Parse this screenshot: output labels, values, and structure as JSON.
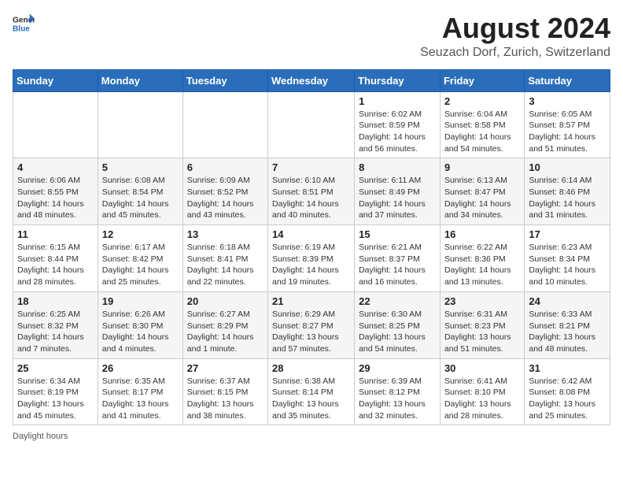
{
  "logo": {
    "text_general": "General",
    "text_blue": "Blue"
  },
  "title": "August 2024",
  "subtitle": "Seuzach Dorf, Zurich, Switzerland",
  "days_of_week": [
    "Sunday",
    "Monday",
    "Tuesday",
    "Wednesday",
    "Thursday",
    "Friday",
    "Saturday"
  ],
  "footer": "Daylight hours",
  "weeks": [
    [
      {
        "day": "",
        "sunrise": "",
        "sunset": "",
        "daylight": ""
      },
      {
        "day": "",
        "sunrise": "",
        "sunset": "",
        "daylight": ""
      },
      {
        "day": "",
        "sunrise": "",
        "sunset": "",
        "daylight": ""
      },
      {
        "day": "",
        "sunrise": "",
        "sunset": "",
        "daylight": ""
      },
      {
        "day": "1",
        "sunrise": "Sunrise: 6:02 AM",
        "sunset": "Sunset: 8:59 PM",
        "daylight": "Daylight: 14 hours and 56 minutes."
      },
      {
        "day": "2",
        "sunrise": "Sunrise: 6:04 AM",
        "sunset": "Sunset: 8:58 PM",
        "daylight": "Daylight: 14 hours and 54 minutes."
      },
      {
        "day": "3",
        "sunrise": "Sunrise: 6:05 AM",
        "sunset": "Sunset: 8:57 PM",
        "daylight": "Daylight: 14 hours and 51 minutes."
      }
    ],
    [
      {
        "day": "4",
        "sunrise": "Sunrise: 6:06 AM",
        "sunset": "Sunset: 8:55 PM",
        "daylight": "Daylight: 14 hours and 48 minutes."
      },
      {
        "day": "5",
        "sunrise": "Sunrise: 6:08 AM",
        "sunset": "Sunset: 8:54 PM",
        "daylight": "Daylight: 14 hours and 45 minutes."
      },
      {
        "day": "6",
        "sunrise": "Sunrise: 6:09 AM",
        "sunset": "Sunset: 8:52 PM",
        "daylight": "Daylight: 14 hours and 43 minutes."
      },
      {
        "day": "7",
        "sunrise": "Sunrise: 6:10 AM",
        "sunset": "Sunset: 8:51 PM",
        "daylight": "Daylight: 14 hours and 40 minutes."
      },
      {
        "day": "8",
        "sunrise": "Sunrise: 6:11 AM",
        "sunset": "Sunset: 8:49 PM",
        "daylight": "Daylight: 14 hours and 37 minutes."
      },
      {
        "day": "9",
        "sunrise": "Sunrise: 6:13 AM",
        "sunset": "Sunset: 8:47 PM",
        "daylight": "Daylight: 14 hours and 34 minutes."
      },
      {
        "day": "10",
        "sunrise": "Sunrise: 6:14 AM",
        "sunset": "Sunset: 8:46 PM",
        "daylight": "Daylight: 14 hours and 31 minutes."
      }
    ],
    [
      {
        "day": "11",
        "sunrise": "Sunrise: 6:15 AM",
        "sunset": "Sunset: 8:44 PM",
        "daylight": "Daylight: 14 hours and 28 minutes."
      },
      {
        "day": "12",
        "sunrise": "Sunrise: 6:17 AM",
        "sunset": "Sunset: 8:42 PM",
        "daylight": "Daylight: 14 hours and 25 minutes."
      },
      {
        "day": "13",
        "sunrise": "Sunrise: 6:18 AM",
        "sunset": "Sunset: 8:41 PM",
        "daylight": "Daylight: 14 hours and 22 minutes."
      },
      {
        "day": "14",
        "sunrise": "Sunrise: 6:19 AM",
        "sunset": "Sunset: 8:39 PM",
        "daylight": "Daylight: 14 hours and 19 minutes."
      },
      {
        "day": "15",
        "sunrise": "Sunrise: 6:21 AM",
        "sunset": "Sunset: 8:37 PM",
        "daylight": "Daylight: 14 hours and 16 minutes."
      },
      {
        "day": "16",
        "sunrise": "Sunrise: 6:22 AM",
        "sunset": "Sunset: 8:36 PM",
        "daylight": "Daylight: 14 hours and 13 minutes."
      },
      {
        "day": "17",
        "sunrise": "Sunrise: 6:23 AM",
        "sunset": "Sunset: 8:34 PM",
        "daylight": "Daylight: 14 hours and 10 minutes."
      }
    ],
    [
      {
        "day": "18",
        "sunrise": "Sunrise: 6:25 AM",
        "sunset": "Sunset: 8:32 PM",
        "daylight": "Daylight: 14 hours and 7 minutes."
      },
      {
        "day": "19",
        "sunrise": "Sunrise: 6:26 AM",
        "sunset": "Sunset: 8:30 PM",
        "daylight": "Daylight: 14 hours and 4 minutes."
      },
      {
        "day": "20",
        "sunrise": "Sunrise: 6:27 AM",
        "sunset": "Sunset: 8:29 PM",
        "daylight": "Daylight: 14 hours and 1 minute."
      },
      {
        "day": "21",
        "sunrise": "Sunrise: 6:29 AM",
        "sunset": "Sunset: 8:27 PM",
        "daylight": "Daylight: 13 hours and 57 minutes."
      },
      {
        "day": "22",
        "sunrise": "Sunrise: 6:30 AM",
        "sunset": "Sunset: 8:25 PM",
        "daylight": "Daylight: 13 hours and 54 minutes."
      },
      {
        "day": "23",
        "sunrise": "Sunrise: 6:31 AM",
        "sunset": "Sunset: 8:23 PM",
        "daylight": "Daylight: 13 hours and 51 minutes."
      },
      {
        "day": "24",
        "sunrise": "Sunrise: 6:33 AM",
        "sunset": "Sunset: 8:21 PM",
        "daylight": "Daylight: 13 hours and 48 minutes."
      }
    ],
    [
      {
        "day": "25",
        "sunrise": "Sunrise: 6:34 AM",
        "sunset": "Sunset: 8:19 PM",
        "daylight": "Daylight: 13 hours and 45 minutes."
      },
      {
        "day": "26",
        "sunrise": "Sunrise: 6:35 AM",
        "sunset": "Sunset: 8:17 PM",
        "daylight": "Daylight: 13 hours and 41 minutes."
      },
      {
        "day": "27",
        "sunrise": "Sunrise: 6:37 AM",
        "sunset": "Sunset: 8:15 PM",
        "daylight": "Daylight: 13 hours and 38 minutes."
      },
      {
        "day": "28",
        "sunrise": "Sunrise: 6:38 AM",
        "sunset": "Sunset: 8:14 PM",
        "daylight": "Daylight: 13 hours and 35 minutes."
      },
      {
        "day": "29",
        "sunrise": "Sunrise: 6:39 AM",
        "sunset": "Sunset: 8:12 PM",
        "daylight": "Daylight: 13 hours and 32 minutes."
      },
      {
        "day": "30",
        "sunrise": "Sunrise: 6:41 AM",
        "sunset": "Sunset: 8:10 PM",
        "daylight": "Daylight: 13 hours and 28 minutes."
      },
      {
        "day": "31",
        "sunrise": "Sunrise: 6:42 AM",
        "sunset": "Sunset: 8:08 PM",
        "daylight": "Daylight: 13 hours and 25 minutes."
      }
    ]
  ]
}
